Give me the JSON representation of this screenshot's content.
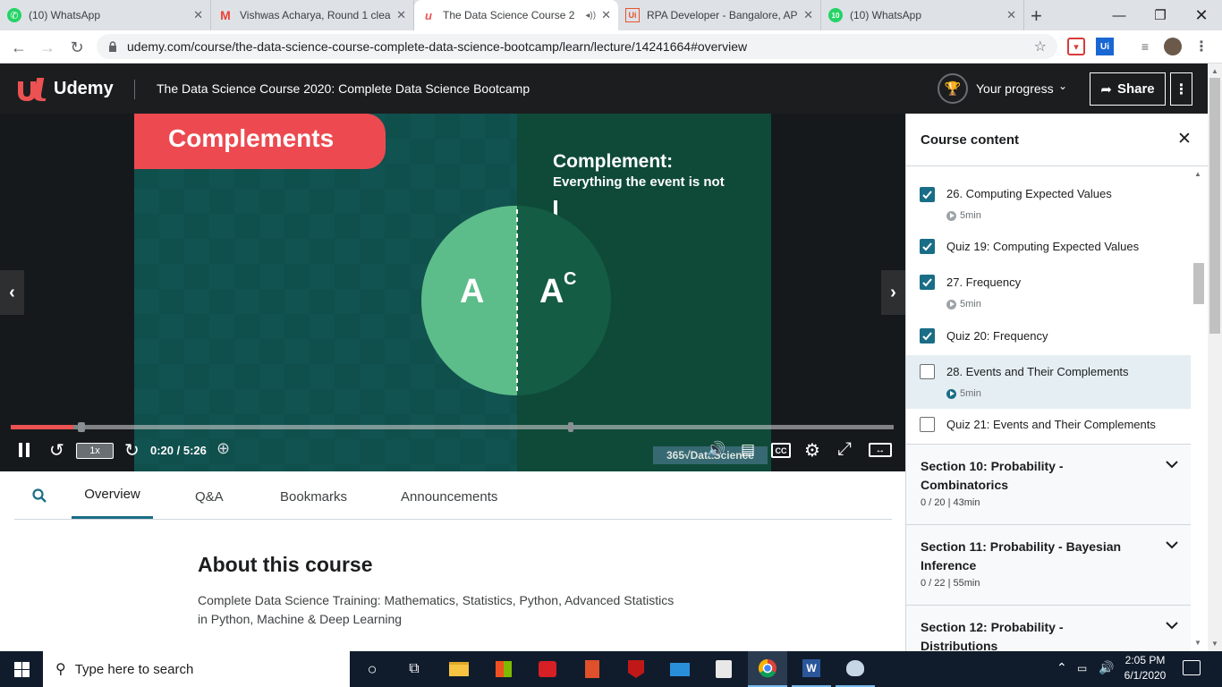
{
  "browser": {
    "tabs": [
      {
        "title": "(10) WhatsApp",
        "icon": "whatsapp-icon"
      },
      {
        "title": "Vishwas Acharya, Round 1 clea",
        "icon": "gmail-icon"
      },
      {
        "title": "The Data Science Course 2",
        "icon": "udemy-icon",
        "active": true
      },
      {
        "title": "RPA Developer - Bangalore, AP",
        "icon": "uipath-icon"
      },
      {
        "title": "(10) WhatsApp",
        "icon": "whatsapp-icon"
      }
    ],
    "new_tab": "+",
    "url": "udemy.com/course/the-data-science-course-complete-data-science-bootcamp/learn/lecture/14241664#overview"
  },
  "header": {
    "logo_text": "Udemy",
    "course_title": "The Data Science Course 2020: Complete Data Science Bootcamp",
    "progress_label": "Your progress",
    "share_label": "Share"
  },
  "video": {
    "slide_title": "Complements",
    "complement_heading": "Complement:",
    "complement_sub": "Everything the event is not",
    "circle_left": "A",
    "circle_right": "A",
    "circle_right_sup": "C",
    "speed": "1x",
    "time": "0:20 / 5:26",
    "watermark": "365√DataScience",
    "cc": "CC",
    "progress": 0.071
  },
  "tabs_below": {
    "overview": "Overview",
    "qa": "Q&A",
    "bookmarks": "Bookmarks",
    "announcements": "Announcements"
  },
  "about": {
    "heading": "About this course",
    "description_line1": "Complete Data Science Training: Mathematics, Statistics, Python, Advanced Statistics",
    "description_line2": "in Python, Machine & Deep Learning"
  },
  "sidebar": {
    "title": "Course content",
    "items": [
      {
        "title": "26. Computing Expected Values",
        "duration": "5min",
        "checked": true
      },
      {
        "title": "Quiz 19: Computing Expected Values",
        "checked": true
      },
      {
        "title": "27. Frequency",
        "duration": "5min",
        "checked": true
      },
      {
        "title": "Quiz 20: Frequency",
        "checked": true
      },
      {
        "title": "28. Events and Their Complements",
        "duration": "5min",
        "checked": false,
        "current": true
      },
      {
        "title": "Quiz 21: Events and Their Complements",
        "checked": false
      }
    ],
    "sections": [
      {
        "line1": "Section 10: Probability -",
        "line2": "Combinatorics",
        "meta": "0 / 20 | 43min"
      },
      {
        "line1": "Section 11: Probability - Bayesian",
        "line2": "Inference",
        "meta": "0 / 22 | 55min"
      },
      {
        "line1": "Section 12: Probability -",
        "line2": "Distributions",
        "meta": ""
      }
    ]
  },
  "taskbar": {
    "search_placeholder": "Type here to search",
    "time": "2:05 PM",
    "date": "6/1/2020"
  },
  "colors": {
    "udemy_purple": "#a435f0",
    "header_bg": "#1c1d1f",
    "slide_red": "#ec5252",
    "slide_green": "#0f4a38",
    "circle_light": "#5dbd8a",
    "circle_dark": "#145c43",
    "check_teal": "#1a6d86"
  }
}
